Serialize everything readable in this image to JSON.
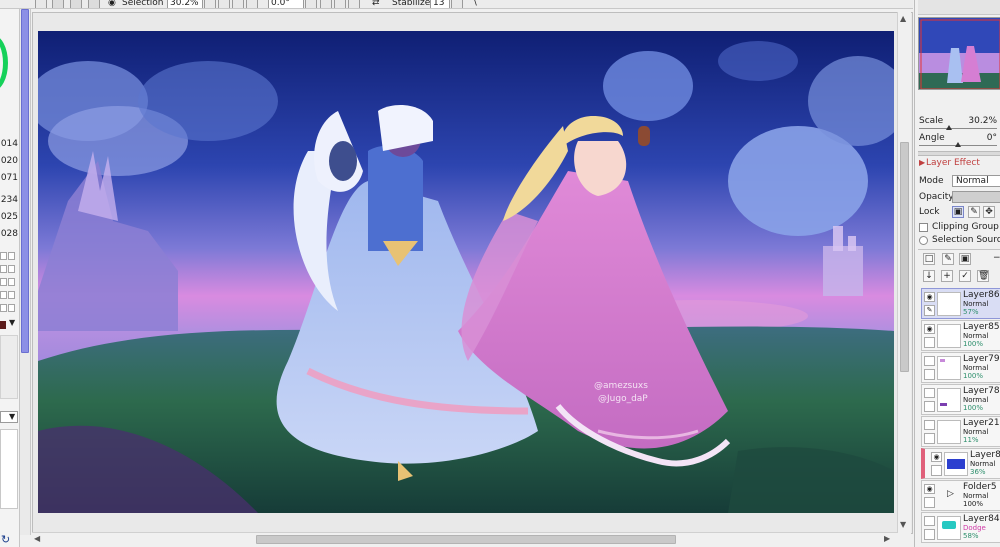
{
  "toolbar": {
    "selection_label": "Selection",
    "zoom_value": "30.2%",
    "angle_value": "0.0°",
    "stabilizer_label": "Stabilizer",
    "stabilizer_value": "13"
  },
  "left_strip": {
    "numbers": [
      "014",
      "020",
      "071",
      "234",
      "025",
      "028"
    ]
  },
  "navigator_panel": {
    "scale_label": "Scale",
    "scale_value": "30.2%",
    "angle_label": "Angle",
    "angle_value": "0°"
  },
  "layer_effect": {
    "header": "Layer Effect",
    "mode_label": "Mode",
    "mode_value": "Normal",
    "opacity_label": "Opacity",
    "lock_label": "Lock",
    "clipping_group_label": "Clipping Group",
    "selection_source_label": "Selection Source"
  },
  "layers": [
    {
      "name": "Layer86",
      "mode": "Normal",
      "opacity": "57%",
      "visible": true,
      "selected": true,
      "color": "#ffffff"
    },
    {
      "name": "Layer85",
      "mode": "Normal",
      "opacity": "100%",
      "visible": true,
      "selected": false,
      "color": "#ffffff"
    },
    {
      "name": "Layer79",
      "mode": "Normal",
      "opacity": "100%",
      "visible": false,
      "selected": false,
      "color": "#ffffff"
    },
    {
      "name": "Layer78",
      "mode": "Normal",
      "opacity": "100%",
      "visible": false,
      "selected": false,
      "color": "#ffffff"
    },
    {
      "name": "Layer21",
      "mode": "Normal",
      "opacity": "11%",
      "visible": false,
      "selected": false,
      "color": "#ffffff"
    },
    {
      "name": "Layer8",
      "mode": "Normal",
      "opacity": "36%",
      "visible": true,
      "selected": false,
      "color": "#2c3fcf"
    },
    {
      "name": "Folder5",
      "mode": "Normal",
      "opacity": "100%",
      "visible": true,
      "selected": false,
      "color": "#ffffff"
    },
    {
      "name": "Layer84",
      "mode": "Dodge",
      "opacity": "58%",
      "visible": false,
      "selected": false,
      "color": "#ffffff"
    }
  ],
  "artwork": {
    "watermark_line1": "@amezsuxs",
    "watermark_line2": "@Jugo_daP"
  },
  "colors": {
    "accent": "#2d8f6c",
    "selected_layer_bg": "#d9ddf4",
    "canvas_sky_top": "#1a2a7a",
    "canvas_sky_horizon": "#d97fd8",
    "canvas_ground": "#2e6a4a"
  }
}
